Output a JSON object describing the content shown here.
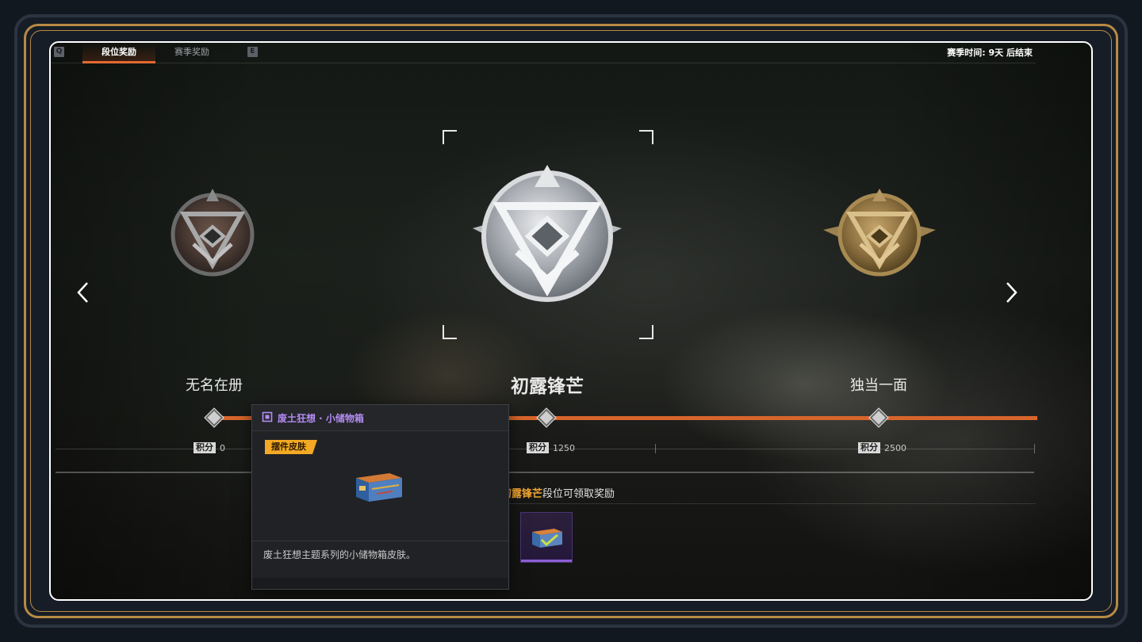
{
  "topbar": {
    "key_left": "Q",
    "tabs": [
      {
        "label": "段位奖励",
        "active": true
      },
      {
        "label": "赛季奖励",
        "active": false
      }
    ],
    "key_right": "E",
    "season_time": "赛季时间: 9天 后结束"
  },
  "ranks": [
    {
      "name": "无名在册",
      "score_label": "积分",
      "score": "0",
      "tier": "bronze"
    },
    {
      "name": "初露锋芒",
      "score_label": "积分",
      "score": "1250",
      "tier": "silver",
      "selected": true
    },
    {
      "name": "独当一面",
      "score_label": "积分",
      "score": "2500",
      "tier": "gold"
    }
  ],
  "rewards": {
    "rank_highlight": "初露锋芒",
    "suffix": "段位可领取奖励"
  },
  "tooltip": {
    "title": "废土狂想 · 小储物箱",
    "type_tag": "摆件皮肤",
    "description": "废土狂想主题系列的小储物箱皮肤。"
  },
  "colors": {
    "accent_orange": "#e2642a",
    "tag_yellow": "#f3a925",
    "epic_purple": "#b48cf2",
    "frame_gold": "#b88a45"
  },
  "icons": [
    "chevron-left-icon",
    "chevron-right-icon",
    "rank-badge-icon",
    "storage-box-icon",
    "check-icon"
  ]
}
